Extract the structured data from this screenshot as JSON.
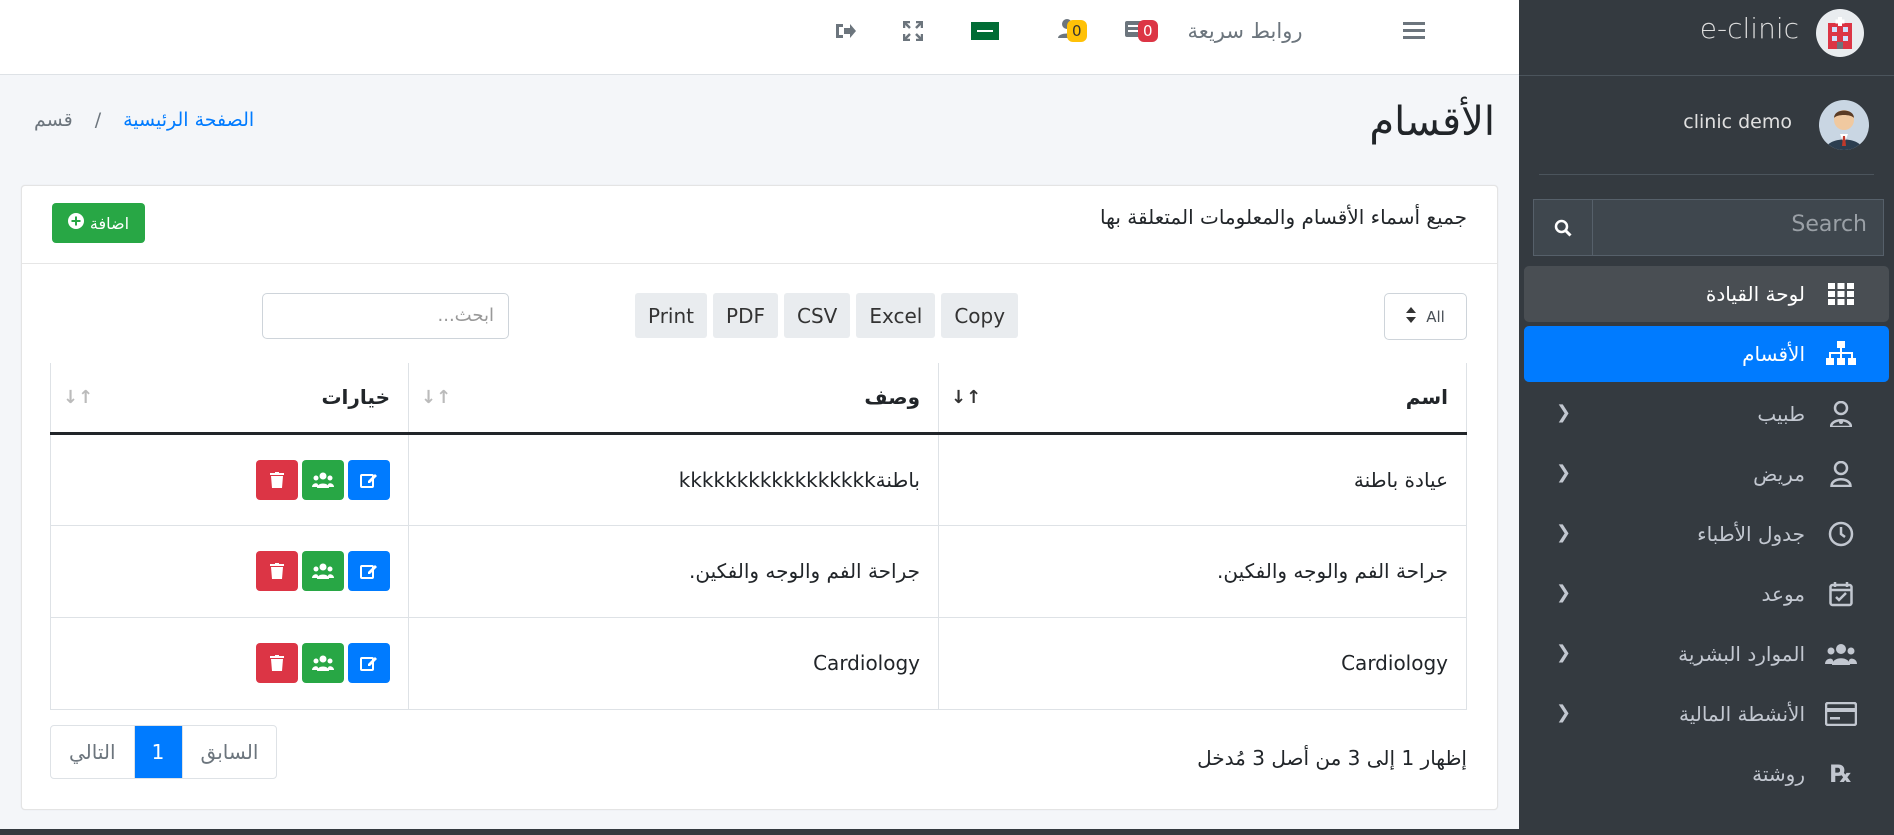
{
  "topbar": {
    "quick_links": "روابط سريعة",
    "notif_count": "0",
    "users_count": "0",
    "colors": {
      "red_badge": "#dc3545",
      "yellow_badge": "#ffc107"
    }
  },
  "sidebar": {
    "brand": "e-clinic",
    "user_name": "clinic demo",
    "search_placeholder": "Search",
    "items": [
      {
        "label": "لوحة القيادة",
        "icon": "grid-icon"
      },
      {
        "label": "الأقسام",
        "icon": "sitemap-icon"
      },
      {
        "label": "طبيب",
        "icon": "doctor-icon"
      },
      {
        "label": "مريض",
        "icon": "user-icon"
      },
      {
        "label": "جدول الأطباء",
        "icon": "clock-icon"
      },
      {
        "label": "موعد",
        "icon": "calendar-check-icon"
      },
      {
        "label": "الموارد البشرية",
        "icon": "users-icon"
      },
      {
        "label": "الأنشطة المالية",
        "icon": "credit-card-icon"
      },
      {
        "label": "روشتة",
        "icon": "prescription-icon"
      }
    ]
  },
  "page": {
    "title": "الأقسام",
    "breadcrumb_home": "الصفحة الرئيسية",
    "breadcrumb_sep": "/",
    "breadcrumb_current": "قسم"
  },
  "card": {
    "title": "جميع أسماء الأقسام والمعلومات المتعلقة بها",
    "add_label": "اضافة",
    "length_value": "All",
    "buttons": {
      "copy": "Copy",
      "excel": "Excel",
      "csv": "CSV",
      "pdf": "PDF",
      "print": "Print"
    },
    "filter_placeholder": "ابحث...",
    "columns": {
      "name": "اسم",
      "desc": "وصف",
      "options": "خيارات"
    },
    "rows": [
      {
        "name": "عيادة باطنة",
        "desc": "باطنةkkkkkkkkkkkkkkkkk"
      },
      {
        "name": "جراحة الفم والوجه والفكين.",
        "desc": "جراحة الفم والوجه والفكين."
      },
      {
        "name": "Cardiology",
        "desc": "Cardiology"
      }
    ],
    "info": "إظهار 1 إلى 3 من أصل 3 مُدخل",
    "pager": {
      "prev": "السابق",
      "current": "1",
      "next": "التالي"
    }
  }
}
